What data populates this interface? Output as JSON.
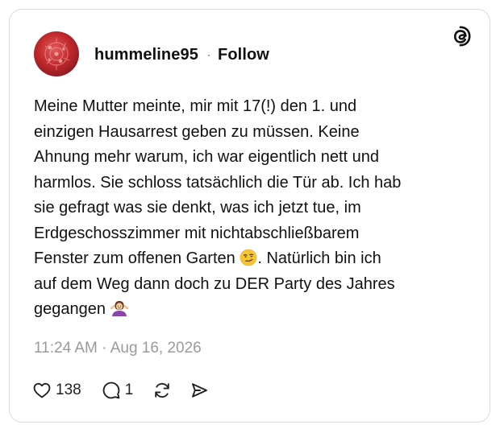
{
  "post": {
    "username": "hummeline95",
    "separator": "·",
    "follow_label": "Follow",
    "text_lines": [
      "Meine Mutter meinte, mir mit 17(!) den 1. und",
      "einzigen Hausarrest geben zu müssen. Keine",
      "Ahnung mehr warum, ich war eigentlich nett und",
      "harmlos. Sie schloss tatsächlich die Tür ab. Ich hab",
      "sie gefragt was sie denkt, was ich jetzt tue, im",
      "Erdgeschosszimmer mit nichtabschließbarem",
      "Fenster zum offenen Garten ",
      ". Natürlich bin ich",
      "auf dem Weg dann doch zu DER Party des Jahres",
      "gegangen "
    ],
    "emojis": [
      "smirking-face-emoji",
      "person-shrugging-emoji"
    ],
    "timestamp": "11:24 AM · Aug 16, 2026"
  },
  "actions": {
    "like_count": "138",
    "reply_count": "1"
  },
  "icons": {
    "logo": "threads-logo-icon",
    "like": "heart-icon",
    "reply": "comment-icon",
    "repost": "repost-icon",
    "share": "send-icon"
  },
  "colors": {
    "text": "#111111",
    "muted": "#9a9a9a",
    "border": "#d9d9d9",
    "avatar": "#c0282c"
  }
}
